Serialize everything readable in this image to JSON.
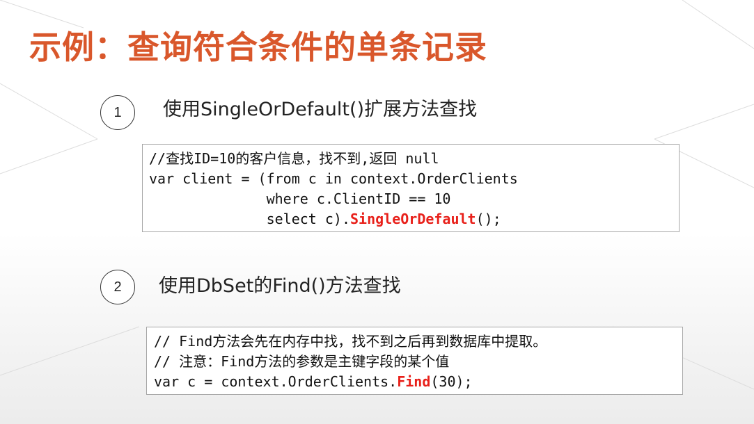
{
  "slide": {
    "title": "示例：查询符合条件的单条记录"
  },
  "steps": [
    {
      "number": "1",
      "heading": "使用SingleOrDefault()扩展方法查找",
      "code": {
        "line1": "//查找ID=10的客户信息，找不到,返回 null",
        "line2": "var client = (from c in context.OrderClients",
        "line3": "              where c.ClientID == 10",
        "line4_pre": "              select c).",
        "line4_hl": "SingleOrDefault",
        "line4_post": "();"
      }
    },
    {
      "number": "2",
      "heading": "使用DbSet的Find()方法查找",
      "code": {
        "line1": "// Find方法会先在内存中找，找不到之后再到数据库中提取。",
        "line2": "// 注意：Find方法的参数是主键字段的某个值",
        "line3_pre": "var c = context.OrderClients.",
        "line3_hl": "Find",
        "line3_post": "(30);"
      }
    }
  ],
  "colors": {
    "title": "#d9572b",
    "highlight": "#e8201a",
    "box_border": "#a6a6a6"
  }
}
